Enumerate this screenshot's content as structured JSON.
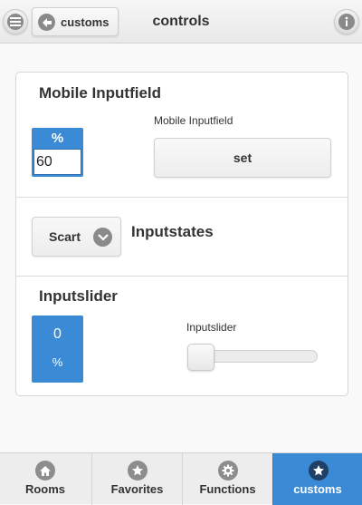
{
  "header": {
    "back_label": "customs",
    "title": "controls",
    "icons": {
      "menu": "menu-icon",
      "back": "arrow-left-icon",
      "info": "info-icon"
    }
  },
  "sections": {
    "mobile_input": {
      "title": "Mobile Inputfield",
      "unit": "%",
      "value": "60",
      "field_label": "Mobile Inputfield",
      "button_label": "set"
    },
    "inputstates": {
      "title": "Inputstates",
      "select_value": "Scart"
    },
    "inputslider": {
      "title": "Inputslider",
      "value": "0",
      "unit": "%",
      "slider_label": "Inputslider",
      "slider_fraction": 0
    }
  },
  "footer": {
    "tabs": [
      {
        "label": "Rooms",
        "icon": "home-icon"
      },
      {
        "label": "Favorites",
        "icon": "star-icon"
      },
      {
        "label": "Functions",
        "icon": "gear-icon"
      },
      {
        "label": "customs",
        "icon": "star-icon",
        "active": true
      }
    ]
  },
  "colors": {
    "accent": "#3a8ad6",
    "header_bg": "#ededed",
    "icon_gray": "#8a8a8a"
  }
}
